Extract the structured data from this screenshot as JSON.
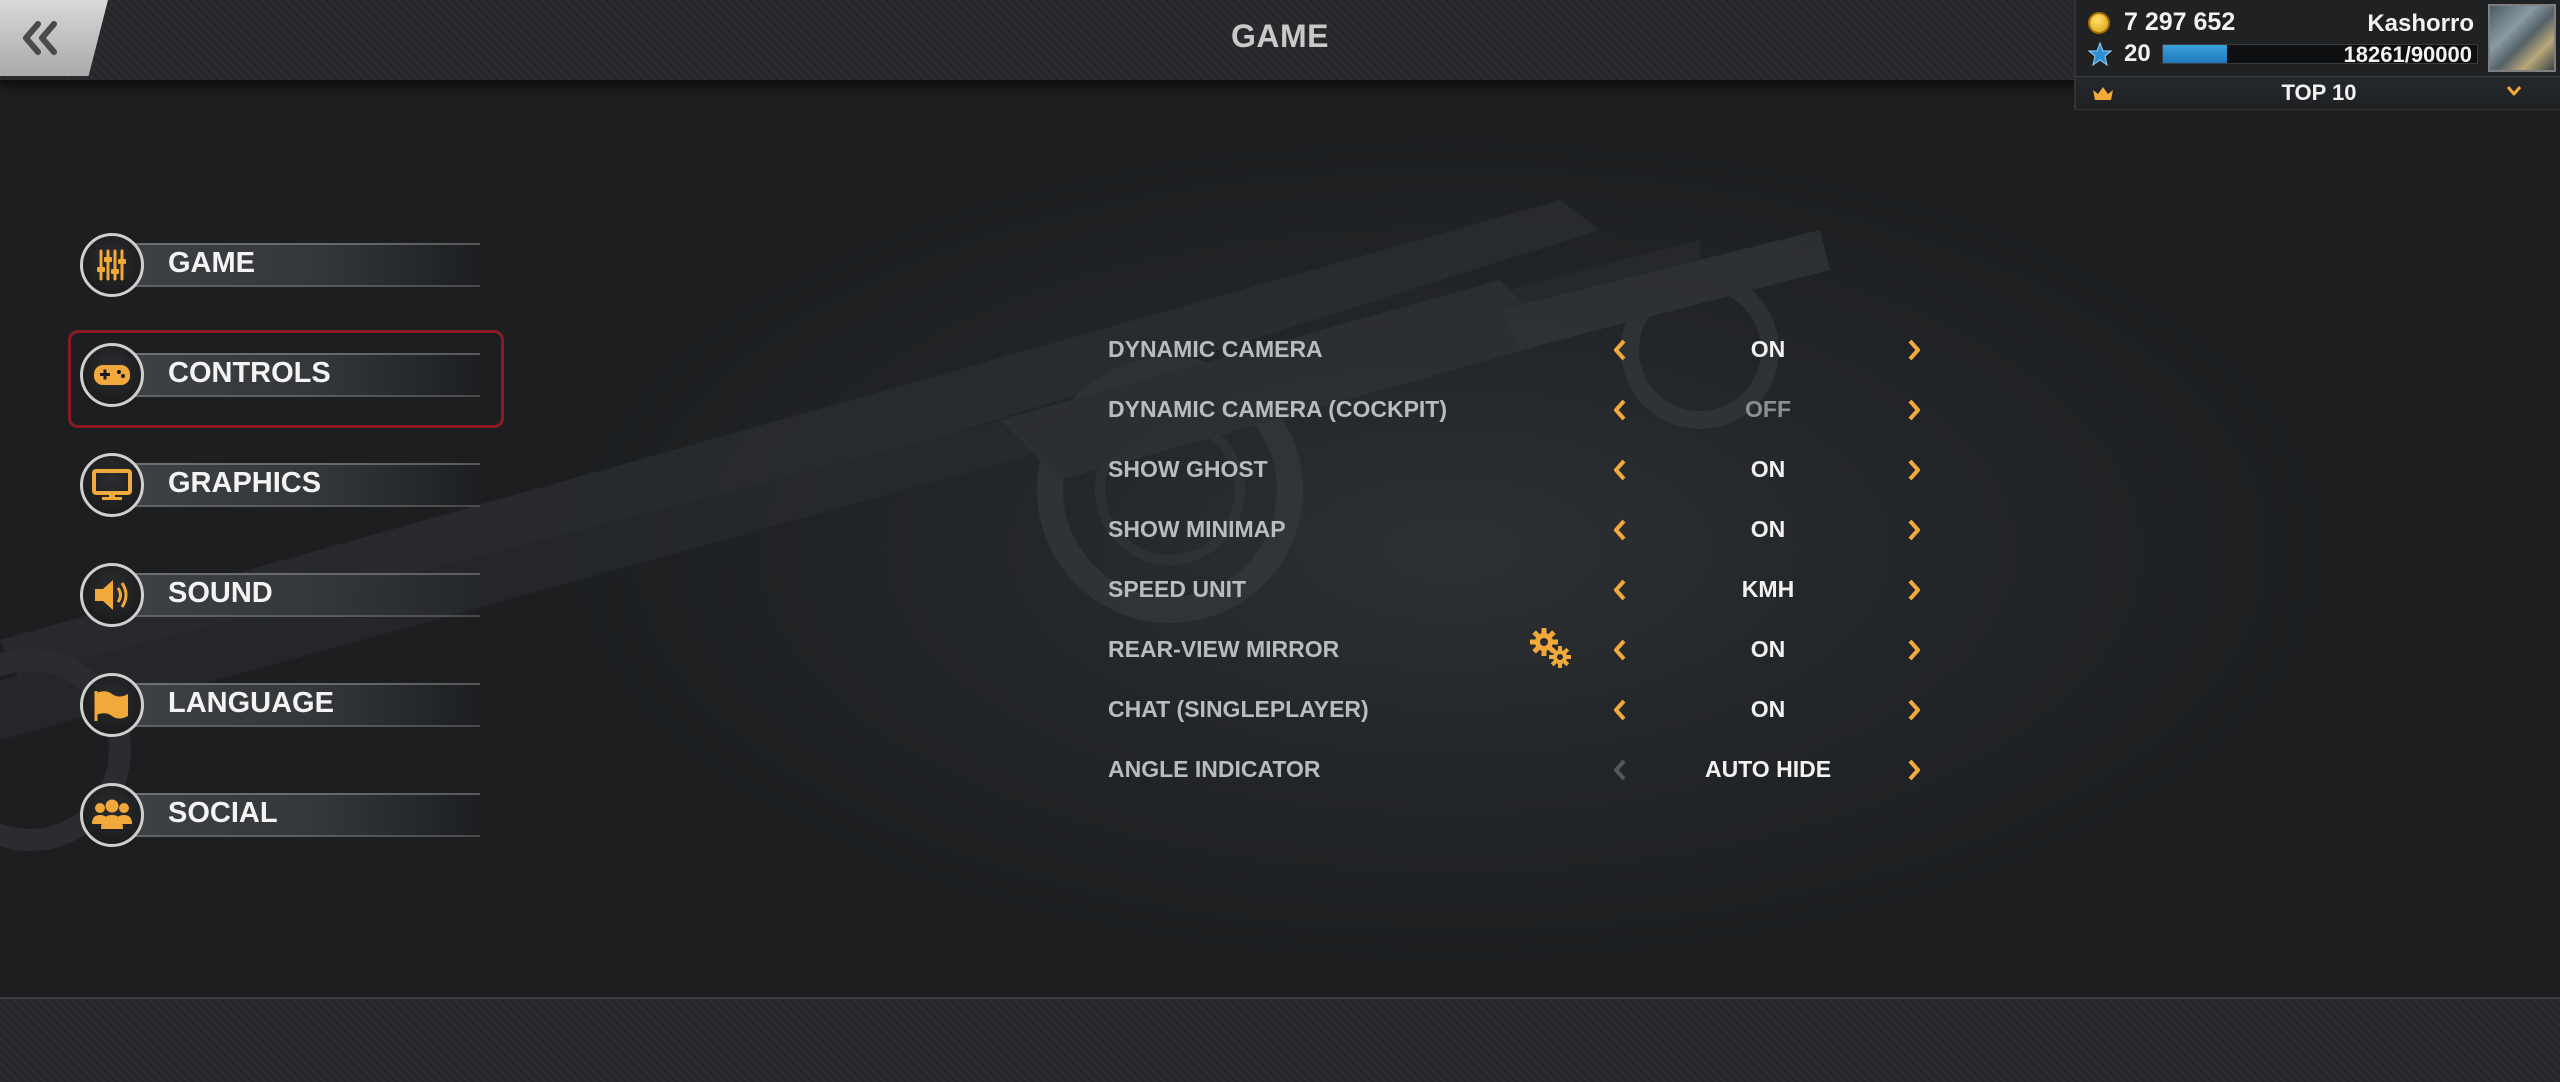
{
  "header": {
    "title": "GAME"
  },
  "player": {
    "coins": "7 297 652",
    "name": "Kashorro",
    "level": "20",
    "xp_text": "18261/90000",
    "xp_fraction": 0.203,
    "rank": "TOP 10"
  },
  "menu": {
    "items": [
      {
        "label": "GAME",
        "icon": "sliders-icon"
      },
      {
        "label": "CONTROLS",
        "icon": "gamepad-icon",
        "selected": true
      },
      {
        "label": "GRAPHICS",
        "icon": "monitor-icon"
      },
      {
        "label": "SOUND",
        "icon": "speaker-icon"
      },
      {
        "label": "LANGUAGE",
        "icon": "flag-icon"
      },
      {
        "label": "SOCIAL",
        "icon": "people-icon"
      }
    ]
  },
  "settings": {
    "rows": [
      {
        "label": "DYNAMIC CAMERA",
        "value": "ON"
      },
      {
        "label": "DYNAMIC CAMERA (COCKPIT)",
        "value": "OFF"
      },
      {
        "label": "SHOW GHOST",
        "value": "ON"
      },
      {
        "label": "SHOW MINIMAP",
        "value": "ON"
      },
      {
        "label": "SPEED UNIT",
        "value": "KMH"
      },
      {
        "label": "REAR-VIEW MIRROR",
        "value": "ON"
      },
      {
        "label": "CHAT (SINGLEPLAYER)",
        "value": "ON"
      },
      {
        "label": "ANGLE INDICATOR",
        "value": "AUTO HIDE"
      }
    ]
  },
  "colors": {
    "accent": "#f2a93b",
    "selection_border": "#8c1a26",
    "xp_bar": "#2a8fd0"
  }
}
